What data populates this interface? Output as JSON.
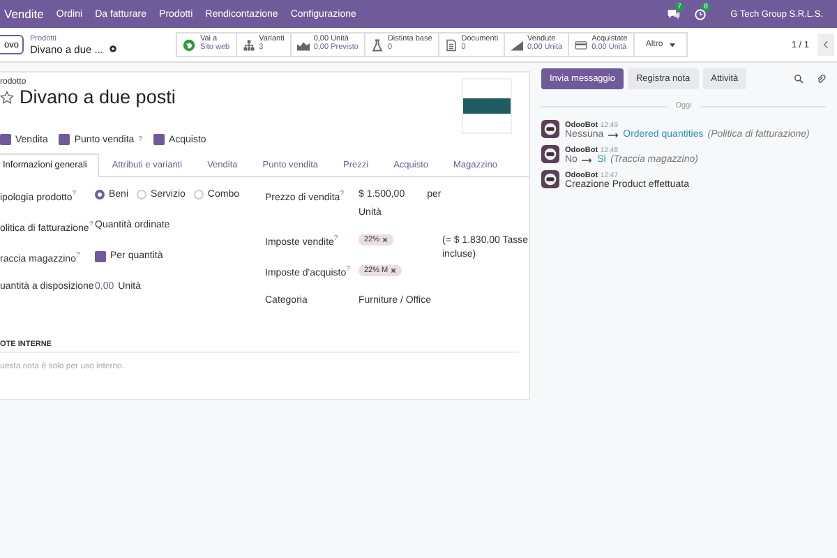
{
  "navbar": {
    "app": "Vendite",
    "menus": [
      "Ordini",
      "Da fatturare",
      "Prodotti",
      "Rendicontazione",
      "Configurazione"
    ],
    "notifications": [
      {
        "kind": "chat",
        "count": "7"
      },
      {
        "kind": "activity",
        "count": "8"
      }
    ],
    "company": "G Tech Group S.R.L.S."
  },
  "control_bar": {
    "new_button": "ovo",
    "breadcrumb": "Prodotti",
    "record": "Divano a due ...",
    "smart_buttons": [
      {
        "kind": "globe",
        "line1": "Vai a",
        "line2": "Sito web"
      },
      {
        "kind": "variants",
        "line1": "Varianti",
        "line2": "3"
      },
      {
        "kind": "chart",
        "line1": "0,00 Unità",
        "line2": "0,00 Previsto"
      },
      {
        "kind": "flask",
        "line1": "Distinta base",
        "line2": "0"
      },
      {
        "kind": "document",
        "line1": "Documenti",
        "line2": "0"
      },
      {
        "kind": "sold",
        "line1": "Vendute",
        "line2": "0,00 Unità"
      },
      {
        "kind": "card",
        "line1": "Acquistate",
        "line2": "0,00 Unità"
      }
    ],
    "more": "Altro",
    "pager": "1 / 1"
  },
  "form": {
    "label": "rodotto",
    "title": "Divano a due posti",
    "starred": false,
    "options": [
      {
        "label": "Vendita",
        "checked": true
      },
      {
        "label": "Punto vendita",
        "checked": true,
        "help": "?"
      },
      {
        "label": "Acquisto",
        "checked": true
      }
    ],
    "tabs": [
      {
        "label": "Informazioni generali",
        "selected": true
      },
      {
        "label": "Attributi e varianti",
        "selected": false
      },
      {
        "label": "Vendita",
        "selected": false
      },
      {
        "label": "Punto vendita",
        "selected": false
      },
      {
        "label": "Prezzi",
        "selected": false
      },
      {
        "label": "Acquisto",
        "selected": false
      },
      {
        "label": "Magazzino",
        "selected": false
      }
    ],
    "left_fields": [
      {
        "kind": "radio",
        "label": "ipologia prodotto",
        "help": "?",
        "choices": [
          {
            "label": "Beni",
            "selected": true
          },
          {
            "label": "Servizio",
            "selected": false
          },
          {
            "label": "Combo",
            "selected": false
          }
        ]
      },
      {
        "kind": "text",
        "label": "olitica di fatturazione",
        "help": "?",
        "value": "Quantità ordinate"
      },
      {
        "kind": "checkbox",
        "label": "raccia magazzino",
        "help": "?",
        "checked": true,
        "value": "Per quantità"
      },
      {
        "kind": "quantity",
        "label": "uantità a disposizione",
        "value": "0,00",
        "unit": "Unità"
      }
    ],
    "right_fields": [
      {
        "kind": "price",
        "label": "Prezzo di vendita",
        "help": "?",
        "value": "$ 1.500,00",
        "per": "per",
        "unit": "Unità"
      },
      {
        "kind": "tags",
        "label": "Imposte vendite",
        "help": "?",
        "tags": [
          "22%"
        ],
        "note": "(= $ 1.830,00 Tasse incluse)"
      },
      {
        "kind": "tags",
        "label": "Imposte d'acquisto",
        "help": "?",
        "tags": [
          "22% M"
        ]
      },
      {
        "kind": "text",
        "label": "Categoria",
        "value": "Furniture / Office"
      }
    ],
    "notes": {
      "title": "OTE INTERNE",
      "placeholder": "uesta nota è solo per uso interno."
    }
  },
  "chatter": {
    "buttons": [
      {
        "label": "Invia messaggio",
        "selected": true
      },
      {
        "label": "Registra nota",
        "selected": false
      },
      {
        "label": "Attività",
        "selected": false
      }
    ],
    "day": "Oggi",
    "messages": [
      {
        "kind": "change",
        "author": "OdooBot",
        "time": "12:49",
        "old": "Nessuna",
        "new": "Ordered quantities",
        "field": "(Politica di fatturazione)"
      },
      {
        "kind": "change",
        "author": "OdooBot",
        "time": "12:48",
        "old": "No",
        "new": "Sì",
        "field": "(Traccia magazzino)"
      },
      {
        "kind": "text",
        "author": "OdooBot",
        "time": "12:47",
        "text": "Creazione Product effettuata"
      }
    ]
  }
}
